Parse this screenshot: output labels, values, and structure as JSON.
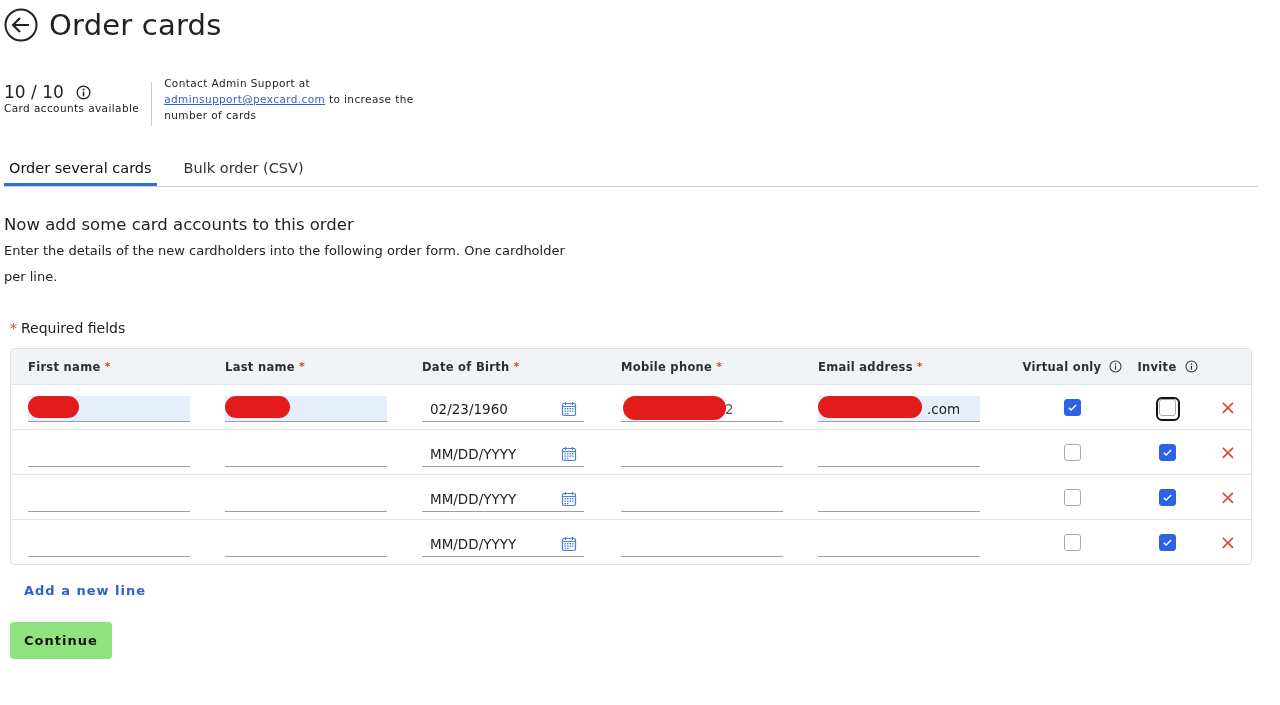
{
  "page": {
    "title": "Order cards"
  },
  "availability": {
    "count": "10 / 10",
    "label": "Card accounts available",
    "contact_before": "Contact Admin Support at",
    "contact_link": "adminsupport@pexcard.com",
    "contact_after": "to increase the number of cards"
  },
  "tabs": [
    {
      "label": "Order several cards",
      "selected": true
    },
    {
      "label": "Bulk order (CSV)",
      "selected": false
    }
  ],
  "section": {
    "heading": "Now add some card accounts to this order",
    "description": "Enter the details of the new cardholders into the following order form. One cardholder per line."
  },
  "required_note": {
    "mark": "*",
    "text": "Required fields"
  },
  "table": {
    "columns": [
      {
        "label": "First name",
        "required": true
      },
      {
        "label": "Last name",
        "required": true
      },
      {
        "label": "Date of Birth",
        "required": true
      },
      {
        "label": "Mobile phone",
        "required": true
      },
      {
        "label": "Email address",
        "required": true
      },
      {
        "label": "Virtual only",
        "info": true
      },
      {
        "label": "Invite",
        "info": true
      }
    ],
    "rows": [
      {
        "first_name": {
          "redacted": true,
          "filled": true
        },
        "last_name": {
          "redacted": true,
          "filled": true
        },
        "dob": {
          "value": "02/23/1960"
        },
        "phone": {
          "value": "2",
          "redacted": true,
          "filled": false
        },
        "email": {
          "value": ".com",
          "redacted": true,
          "filled": true
        },
        "virtual_only": {
          "checked": true
        },
        "invite": {
          "checked": false,
          "focused": true
        },
        "delete": "×"
      },
      {
        "first_name": {
          "filled": false
        },
        "last_name": {
          "filled": false
        },
        "dob": {
          "placeholder": "MM/DD/YYYY"
        },
        "phone": {
          "filled": false
        },
        "email": {
          "filled": false
        },
        "virtual_only": {
          "checked": false
        },
        "invite": {
          "checked": true
        },
        "delete": "×"
      },
      {
        "first_name": {
          "filled": false
        },
        "last_name": {
          "filled": false
        },
        "dob": {
          "placeholder": "MM/DD/YYYY"
        },
        "phone": {
          "filled": false
        },
        "email": {
          "filled": false
        },
        "virtual_only": {
          "checked": false
        },
        "invite": {
          "checked": true
        },
        "delete": "×"
      },
      {
        "first_name": {
          "filled": false
        },
        "last_name": {
          "filled": false
        },
        "dob": {
          "placeholder": "MM/DD/YYYY"
        },
        "phone": {
          "filled": false
        },
        "email": {
          "filled": false
        },
        "virtual_only": {
          "checked": false
        },
        "invite": {
          "checked": true
        },
        "delete": "×"
      }
    ]
  },
  "add_line": "Add a new line",
  "continue_button": "Continue"
}
